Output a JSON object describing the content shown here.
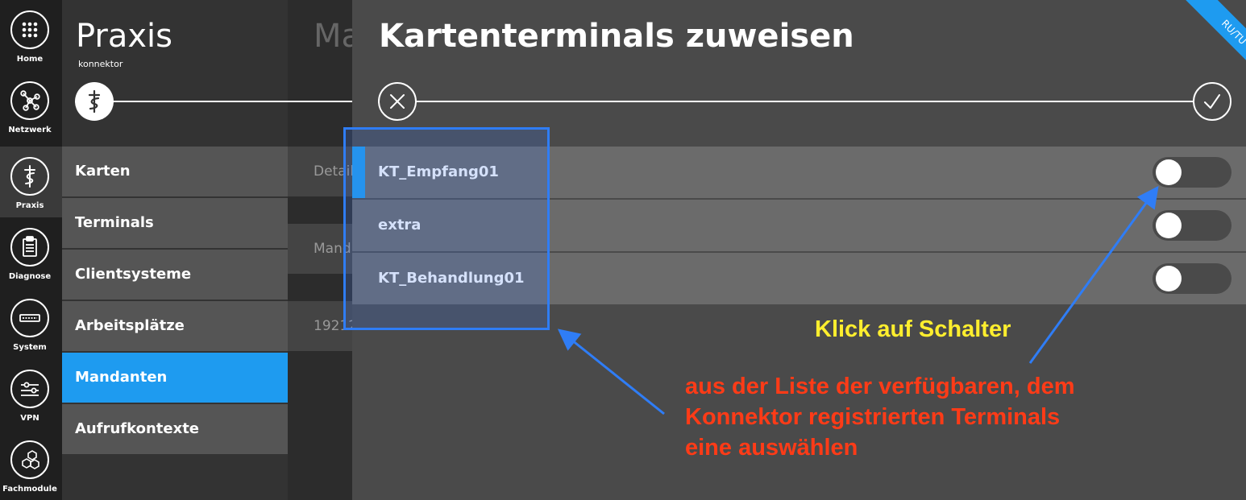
{
  "rail": {
    "items": [
      {
        "label": "Home",
        "icon": "grid-icon"
      },
      {
        "label": "Netzwerk",
        "icon": "network-icon"
      },
      {
        "label": "Praxis",
        "icon": "caduceus-icon"
      },
      {
        "label": "Diagnose",
        "icon": "clipboard-icon"
      },
      {
        "label": "System",
        "icon": "device-icon"
      },
      {
        "label": "VPN",
        "icon": "vpn-icon"
      },
      {
        "label": "Fachmodule",
        "icon": "hexagons-icon"
      }
    ]
  },
  "menu": {
    "title": "Praxis",
    "subtitle": "konnektor",
    "items": [
      {
        "label": "Karten"
      },
      {
        "label": "Terminals"
      },
      {
        "label": "Clientsysteme"
      },
      {
        "label": "Arbeitsplätze"
      },
      {
        "label": "Mandanten"
      },
      {
        "label": "Aufrufkontexte"
      }
    ],
    "selected": "Mandanten"
  },
  "middle": {
    "title": "Ma",
    "rows": [
      "Detail",
      "Mand",
      "19212"
    ]
  },
  "panel": {
    "title": "Kartenterminals zuweisen",
    "terminals": [
      {
        "name": "KT_Empfang01",
        "enabled": false,
        "highlighted": true
      },
      {
        "name": "extra",
        "enabled": false,
        "highlighted": false
      },
      {
        "name": "KT_Behandlung01",
        "enabled": false,
        "highlighted": false
      }
    ]
  },
  "ribbon": {
    "text": "RU/TU"
  },
  "annotations": {
    "yellow": "Klick auf Schalter",
    "red_lines": [
      "aus der Liste der verfügbaren, dem",
      "Konnektor registrierten Terminals",
      "eine auswählen"
    ]
  },
  "colors": {
    "accent": "#1e9bf0",
    "annotation_blue": "#2f7df6",
    "annotation_yellow": "#ffee2e",
    "annotation_red": "#ff3b17"
  }
}
